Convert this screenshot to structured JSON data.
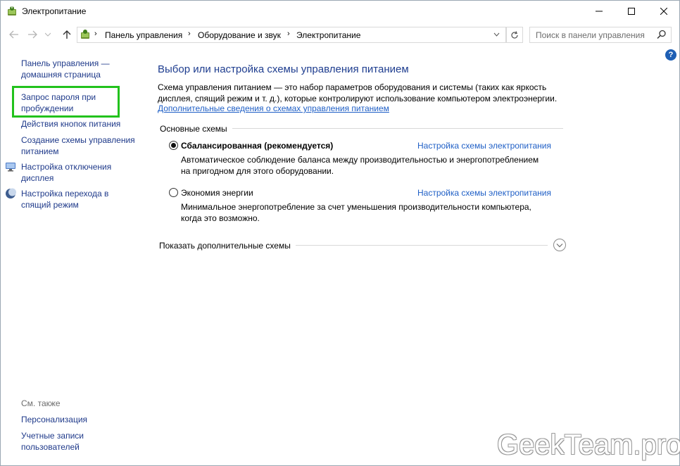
{
  "window": {
    "title": "Электропитание"
  },
  "address_bar": {
    "breadcrumbs": [
      "Панель управления",
      "Оборудование и звук",
      "Электропитание"
    ]
  },
  "search": {
    "placeholder": "Поиск в панели управления"
  },
  "help": {
    "label": "?"
  },
  "sidebar": {
    "items": [
      {
        "line1": "Панель управления —",
        "line2": "домашняя страница"
      },
      {
        "line1": "Запрос пароля при",
        "line2": "пробуждении"
      },
      {
        "line1": "Действия кнопок питания",
        "line2": ""
      },
      {
        "line1": "Создание схемы управления",
        "line2": "питанием"
      },
      {
        "line1": "Настройка отключения",
        "line2": "дисплея"
      },
      {
        "line1": "Настройка перехода в",
        "line2": "спящий режим"
      }
    ],
    "see_also": {
      "label": "См. также",
      "items": [
        {
          "line1": "Персонализация",
          "line2": ""
        },
        {
          "line1": "Учетные записи",
          "line2": "пользователей"
        }
      ]
    }
  },
  "main": {
    "title": "Выбор или настройка схемы управления питанием",
    "description_line1": "Схема управления питанием — это набор параметров оборудования и системы (таких как яркость",
    "description_line2": "дисплея, спящий режим и т. д.), которые контролируют использование компьютером электроэнергии.",
    "more_info_link": "Дополнительные сведения о схемах управления питанием",
    "group_label": "Основные схемы",
    "plans": [
      {
        "name": "Сбалансированная (рекомендуется)",
        "selected": true,
        "settings_link": "Настройка схемы электропитания",
        "desc_line1": "Автоматическое соблюдение баланса между производительностью и энергопотреблением",
        "desc_line2": "на пригодном для этого оборудовании."
      },
      {
        "name": "Экономия энергии",
        "selected": false,
        "settings_link": "Настройка схемы электропитания",
        "desc_line1": "Минимальное энергопотребление за счет уменьшения производительности компьютера,",
        "desc_line2": "когда это возможно."
      }
    ],
    "show_more_label": "Показать дополнительные схемы"
  },
  "watermark": {
    "text": "GeekTeam.pro"
  },
  "colors": {
    "link": "#1f5fc6",
    "title": "#1e3d8f",
    "highlight": "#22c21c"
  }
}
